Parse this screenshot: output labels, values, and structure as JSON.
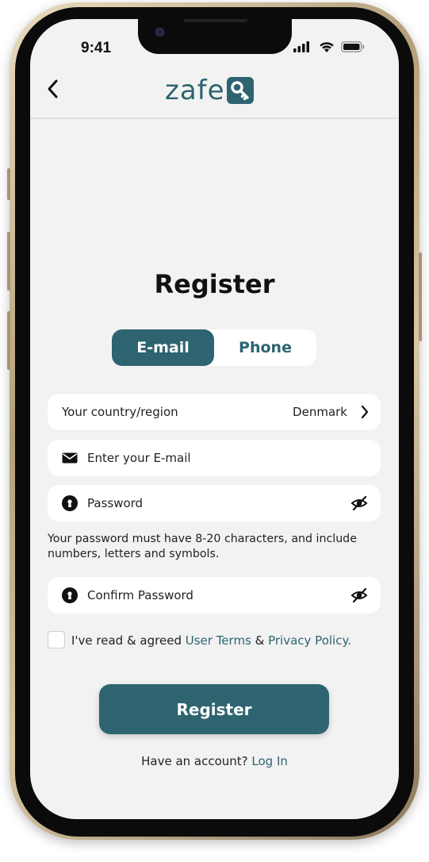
{
  "status_bar": {
    "time": "9:41"
  },
  "header": {
    "logo_text": "zafe"
  },
  "page": {
    "title": "Register"
  },
  "tabs": [
    {
      "label": "E-mail",
      "selected": true
    },
    {
      "label": "Phone",
      "selected": false
    }
  ],
  "form": {
    "country_label": "Your country/region",
    "country_value": "Denmark",
    "email_placeholder": "Enter your E-mail",
    "password_placeholder": "Password",
    "password_hint": "Your password must have 8-20 characters, and include numbers, letters and symbols.",
    "confirm_placeholder": "Confirm Password"
  },
  "terms": {
    "prefix": "I've read & agreed ",
    "user_terms": "User Terms",
    "amp": " & ",
    "privacy_policy": "Privacy Policy."
  },
  "actions": {
    "register_label": "Register"
  },
  "login": {
    "prompt": "Have an account? ",
    "link": "Log In"
  },
  "colors": {
    "brand": "#2d6470",
    "background": "#f2f2f2",
    "field": "#ffffff"
  }
}
